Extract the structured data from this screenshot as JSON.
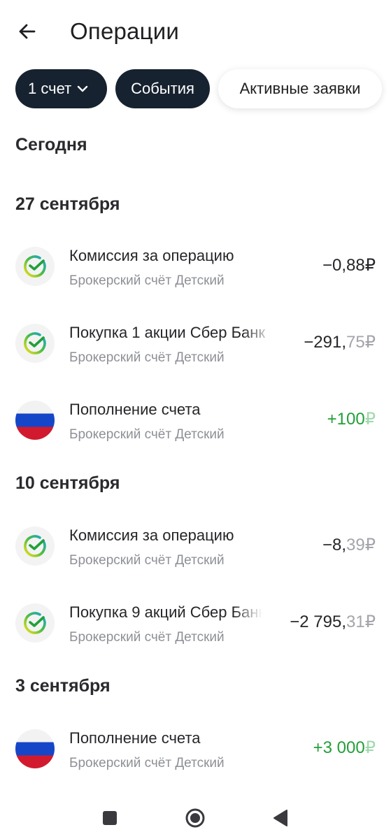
{
  "header": {
    "title": "Операции",
    "back_icon": "arrow-left-icon"
  },
  "filters": {
    "account_label": "1 счет",
    "events_label": "События",
    "active_orders_label": "Активные заявки"
  },
  "sections": {
    "today": "Сегодня",
    "sep27": "27 сентября",
    "sep10": "10 сентября",
    "sep3": "3 сентября"
  },
  "operations": [
    {
      "title": "Комиссия за операцию",
      "subtitle": "Брокерский счёт Детский",
      "amount_int": "−0,88",
      "amount_frac": "",
      "currency": "₽",
      "icon": "sber-logo-icon"
    },
    {
      "title": "Покупка 1 акции Сбер Банк",
      "subtitle": "Брокерский счёт Детский",
      "amount_int": "−291,",
      "amount_frac": "75",
      "currency": "₽",
      "icon": "sber-logo-icon"
    },
    {
      "title": "Пополнение счета",
      "subtitle": "Брокерский счёт Детский",
      "amount_int": "+100",
      "amount_frac": "",
      "currency": "₽",
      "icon": "russia-flag-icon"
    },
    {
      "title": "Комиссия за операцию",
      "subtitle": "Брокерский счёт Детский",
      "amount_int": "−8,",
      "amount_frac": "39",
      "currency": "₽",
      "icon": "sber-logo-icon"
    },
    {
      "title": "Покупка 9 акций Сбер Банк",
      "subtitle": "Брокерский счёт Детский",
      "amount_int": "−2 795,",
      "amount_frac": "31",
      "currency": "₽",
      "icon": "sber-logo-icon"
    },
    {
      "title": "Пополнение счета",
      "subtitle": "Брокерский счёт Детский",
      "amount_int": "+3 000",
      "amount_frac": "",
      "currency": "₽",
      "icon": "russia-flag-icon"
    }
  ],
  "colors": {
    "chip_dark": "#172230",
    "positive": "#21a038",
    "muted": "#8e9096"
  },
  "system_nav": {
    "recents_icon": "square-icon",
    "home_icon": "circle-icon",
    "back_icon": "triangle-back-icon"
  }
}
